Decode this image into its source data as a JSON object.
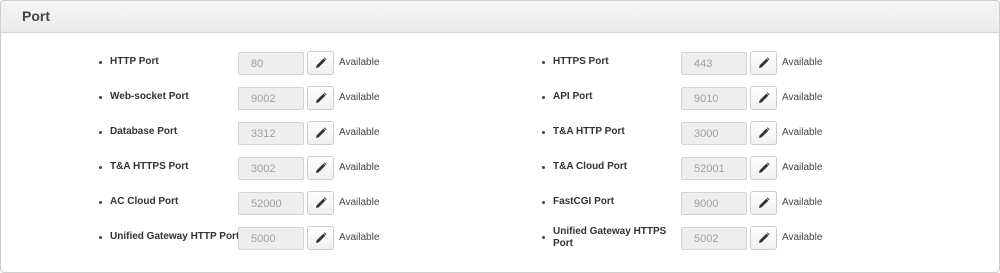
{
  "panel": {
    "title": "Port"
  },
  "left_ports": [
    {
      "label": "HTTP Port",
      "value": "80",
      "status": "Available"
    },
    {
      "label": "Web-socket Port",
      "value": "9002",
      "status": "Available"
    },
    {
      "label": "Database Port",
      "value": "3312",
      "status": "Available"
    },
    {
      "label": "T&A HTTPS Port",
      "value": "3002",
      "status": "Available"
    },
    {
      "label": "AC Cloud Port",
      "value": "52000",
      "status": "Available"
    },
    {
      "label": "Unified Gateway HTTP Port",
      "value": "5000",
      "status": "Available"
    }
  ],
  "right_ports": [
    {
      "label": "HTTPS Port",
      "value": "443",
      "status": "Available"
    },
    {
      "label": "API Port",
      "value": "9010",
      "status": "Available"
    },
    {
      "label": "T&A HTTP Port",
      "value": "3000",
      "status": "Available"
    },
    {
      "label": "T&A Cloud Port",
      "value": "52001",
      "status": "Available"
    },
    {
      "label": "FastCGI Port",
      "value": "9000",
      "status": "Available"
    },
    {
      "label": "Unified Gateway HTTPS Port",
      "value": "5002",
      "status": "Available"
    }
  ],
  "icons": {
    "edit": "pencil-icon"
  }
}
